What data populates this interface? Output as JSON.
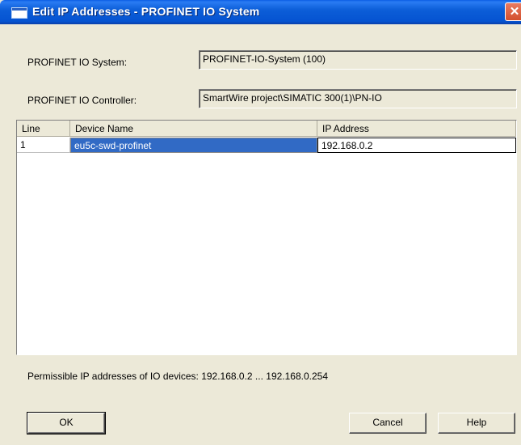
{
  "window": {
    "title": "Edit IP Addresses - PROFINET IO System",
    "close_glyph": "✕"
  },
  "form": {
    "system_label": "PROFINET IO System:",
    "system_value": "PROFINET-IO-System (100)",
    "controller_label": "PROFINET IO Controller:",
    "controller_value": "SmartWire project\\SIMATIC 300(1)\\PN-IO"
  },
  "table": {
    "columns": [
      "Line",
      "Device Name",
      "IP Address"
    ],
    "rows": [
      {
        "line": "1",
        "device_name": "eu5c-swd-profinet",
        "ip_address": "192.168.0.2"
      }
    ]
  },
  "info_text": "Permissible IP addresses of IO devices: 192.168.0.2 ... 192.168.0.254",
  "buttons": {
    "ok": "OK",
    "cancel": "Cancel",
    "help": "Help"
  }
}
